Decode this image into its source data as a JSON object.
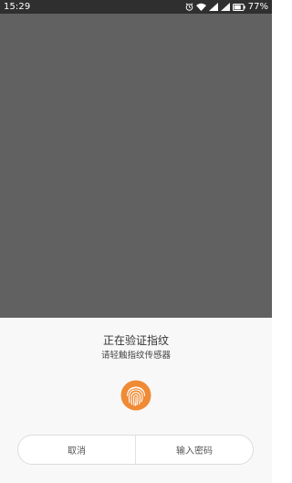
{
  "status_bar": {
    "time": "15:29",
    "battery_percent": "77%",
    "icons": [
      "alarm-icon",
      "wifi-icon",
      "signal-icon",
      "signal-icon",
      "battery-icon"
    ]
  },
  "dialog": {
    "title": "正在验证指纹",
    "subtitle": "请轻触指纹传感器",
    "icon": "fingerprint-icon",
    "accent_color": "#f08a35",
    "cancel_label": "取消",
    "password_label": "输入密码"
  },
  "colors": {
    "overlay": "#616161",
    "status_bar": "#2f2f2f",
    "dialog_background": "#f8f8f8"
  }
}
